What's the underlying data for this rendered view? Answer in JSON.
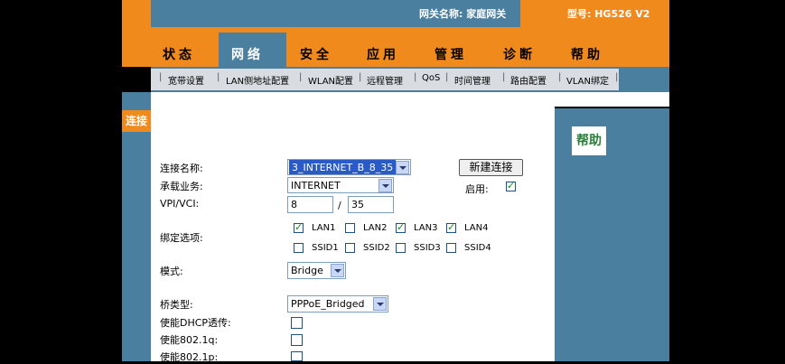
{
  "header": {
    "gateway_name": "网关名称: 家庭网关",
    "model": "型号: HG526 V2"
  },
  "nav": {
    "items": [
      "状态",
      "网络",
      "安全",
      "应用",
      "管理",
      "诊断",
      "帮助"
    ],
    "active": "网络"
  },
  "subnav": {
    "items": [
      "宽带设置",
      "LAN侧地址配置",
      "WLAN配置",
      "远程管理",
      "QoS",
      "时间管理",
      "路由配置",
      "VLAN绑定"
    ]
  },
  "left_tab": "连接",
  "help": "帮助",
  "form": {
    "connection_name_label": "连接名称:",
    "connection_name_value": "3_INTERNET_B_8_35",
    "new_connection_button": "新建连接",
    "service_label": "承载业务:",
    "service_value": "INTERNET",
    "enable_label": "启用:",
    "enable_checked": true,
    "vpi_vci_label": "VPI/VCI:",
    "vpi": "8",
    "vci_sep": "/",
    "vci": "35",
    "binding_label": "绑定选项:",
    "bindings": [
      {
        "label": "LAN1",
        "checked": true
      },
      {
        "label": "LAN2",
        "checked": false
      },
      {
        "label": "LAN3",
        "checked": true
      },
      {
        "label": "LAN4",
        "checked": true
      },
      {
        "label": "SSID1",
        "checked": false
      },
      {
        "label": "SSID2",
        "checked": false
      },
      {
        "label": "SSID3",
        "checked": false
      },
      {
        "label": "SSID4",
        "checked": false
      }
    ],
    "mode_label": "模式:",
    "mode_value": "Bridge",
    "bridge_type_label": "桥类型:",
    "bridge_type_value": "PPPoE_Bridged",
    "dhcp_label": "使能DHCP透传:",
    "dot1q_label": "使能802.1q:",
    "dot1p_label": "使能802.1p:"
  },
  "colors": {
    "orange": "#f08a1c",
    "blue": "#4a7f9f"
  }
}
